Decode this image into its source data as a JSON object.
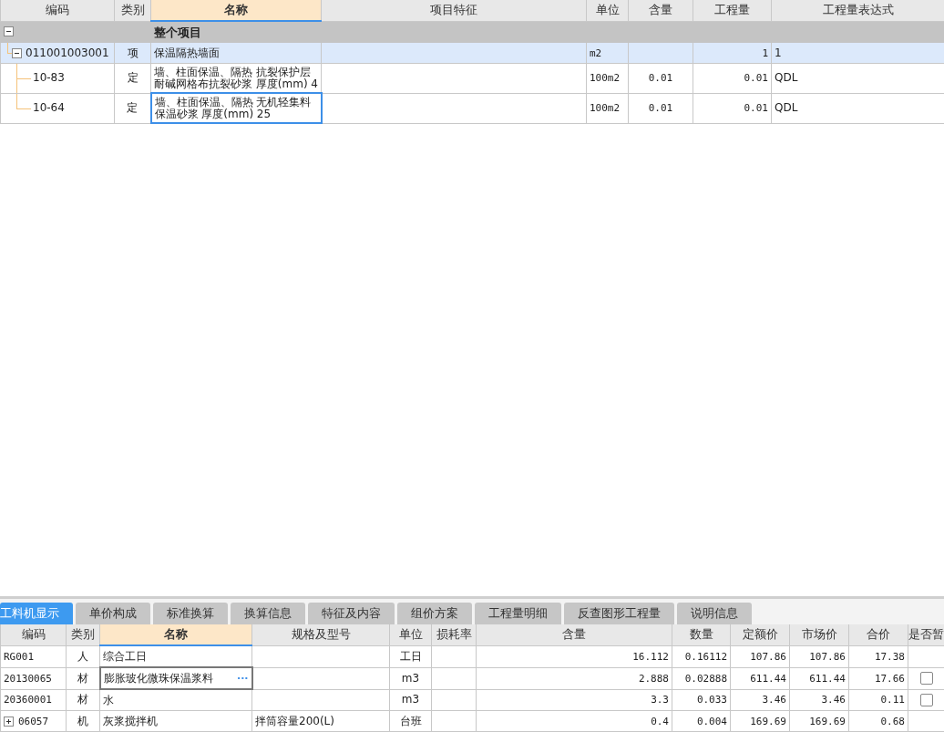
{
  "top_table": {
    "columns": [
      {
        "label": "编码",
        "selected": false
      },
      {
        "label": "类别",
        "selected": false
      },
      {
        "label": "名称",
        "selected": true
      },
      {
        "label": "项目特征",
        "selected": false
      },
      {
        "label": "单位",
        "selected": false
      },
      {
        "label": "含量",
        "selected": false
      },
      {
        "label": "工程量",
        "selected": false
      },
      {
        "label": "工程量表达式",
        "selected": false
      }
    ],
    "rows": [
      {
        "kind": "group",
        "name": "整个项目",
        "expanded": true,
        "selected": false,
        "focused": false,
        "children": [
          {
            "kind": "item",
            "code": "011001003001",
            "type": "项",
            "name": "保温隔热墙面",
            "unit": "m2",
            "quantity": "1",
            "expression": "1",
            "expanded": true,
            "selected": true,
            "focused": false,
            "children": [
              {
                "kind": "sub",
                "code": "10-83",
                "type": "定",
                "name": "墙、柱面保温、隔热 抗裂保护层耐碱网格布抗裂砂浆 厚度(mm) 4",
                "unit": "100m2",
                "content": "0.01",
                "quantity": "0.01",
                "expression": "QDL",
                "selected": false,
                "focused": false
              },
              {
                "kind": "sub",
                "code": "10-64",
                "type": "定",
                "name": "墙、柱面保温、隔热 无机轻集料保温砂浆 厚度(mm) 25",
                "unit": "100m2",
                "content": "0.01",
                "quantity": "0.01",
                "expression": "QDL",
                "selected": false,
                "focused": true
              }
            ]
          }
        ]
      }
    ]
  },
  "bottom_tabs": [
    {
      "label": "工料机显示",
      "selected": true
    },
    {
      "label": "单价构成",
      "selected": false
    },
    {
      "label": "标准换算",
      "selected": false
    },
    {
      "label": "换算信息",
      "selected": false
    },
    {
      "label": "特征及内容",
      "selected": false
    },
    {
      "label": "组价方案",
      "selected": false
    },
    {
      "label": "工程量明细",
      "selected": false
    },
    {
      "label": "反查图形工程量",
      "selected": false
    },
    {
      "label": "说明信息",
      "selected": false
    }
  ],
  "bottom_table": {
    "columns": [
      {
        "label": "编码",
        "selected": false
      },
      {
        "label": "类别",
        "selected": false
      },
      {
        "label": "名称",
        "selected": true
      },
      {
        "label": "规格及型号",
        "selected": false
      },
      {
        "label": "单位",
        "selected": false
      },
      {
        "label": "损耗率",
        "selected": false
      },
      {
        "label": "含量",
        "selected": false
      },
      {
        "label": "数量",
        "selected": false
      },
      {
        "label": "定额价",
        "selected": false
      },
      {
        "label": "市场价",
        "selected": false
      },
      {
        "label": "合价",
        "selected": false
      },
      {
        "label": "是否暂",
        "selected": false
      }
    ],
    "rows": [
      {
        "code": "RG001",
        "type": "人",
        "name": "综合工日",
        "unit": "工日",
        "content": "16.112",
        "amount": "0.16112",
        "quota_price": "107.86",
        "market_price": "107.86",
        "total": "17.38",
        "focused": false
      },
      {
        "code": "20130065",
        "type": "材",
        "name": "膨胀玻化微珠保温浆料",
        "name_button": "···",
        "unit": "m3",
        "content": "2.888",
        "amount": "0.02888",
        "quota_price": "611.44",
        "market_price": "611.44",
        "total": "17.66",
        "provisional": false,
        "focused": true
      },
      {
        "code": "20360001",
        "type": "材",
        "name": "水",
        "unit": "m3",
        "content": "3.3",
        "amount": "0.033",
        "quota_price": "3.46",
        "market_price": "3.46",
        "total": "0.11",
        "provisional": false,
        "focused": false
      },
      {
        "code": "06057",
        "type": "机",
        "name": "灰浆搅拌机",
        "spec": "拌筒容量200(L)",
        "unit": "台班",
        "content": "0.4",
        "amount": "0.004",
        "quota_price": "169.69",
        "market_price": "169.69",
        "total": "0.68",
        "expanded": false,
        "focused": false
      }
    ]
  }
}
